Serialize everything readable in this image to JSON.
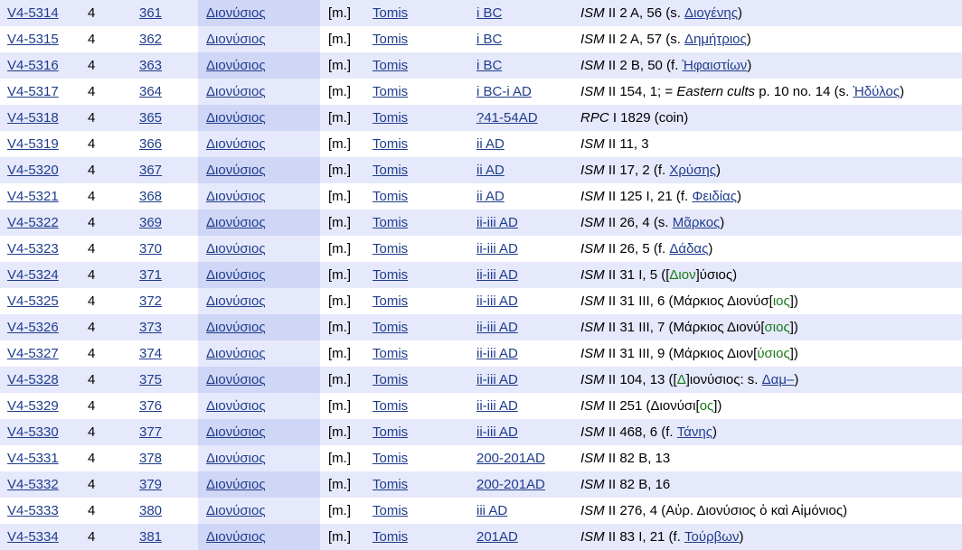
{
  "rows": [
    {
      "id": "V4-5314",
      "vol": "4",
      "num": "361",
      "name": "Διονύσιος",
      "sex": "[m.]",
      "place": "Tomis",
      "date": "i BC",
      "ref": [
        {
          "t": "ISM",
          "i": 1
        },
        {
          "t": " II 2 A, 56 (s. "
        },
        {
          "t": "Διογένης",
          "l": 1
        },
        {
          "t": ")"
        }
      ]
    },
    {
      "id": "V4-5315",
      "vol": "4",
      "num": "362",
      "name": "Διονύσιος",
      "sex": "[m.]",
      "place": "Tomis",
      "date": "i BC",
      "ref": [
        {
          "t": "ISM",
          "i": 1
        },
        {
          "t": " II 2 A, 57 (s. "
        },
        {
          "t": "Δημήτριος",
          "l": 1
        },
        {
          "t": ")"
        }
      ]
    },
    {
      "id": "V4-5316",
      "vol": "4",
      "num": "363",
      "name": "Διονύσιος",
      "sex": "[m.]",
      "place": "Tomis",
      "date": "i BC",
      "ref": [
        {
          "t": "ISM",
          "i": 1
        },
        {
          "t": " II 2 B, 50 (f. "
        },
        {
          "t": "Ἡφαιστίων",
          "l": 1
        },
        {
          "t": ")"
        }
      ]
    },
    {
      "id": "V4-5317",
      "vol": "4",
      "num": "364",
      "name": "Διονύσιος",
      "sex": "[m.]",
      "place": "Tomis",
      "date": "i BC-i AD",
      "ref": [
        {
          "t": "ISM",
          "i": 1
        },
        {
          "t": " II 154, 1; = "
        },
        {
          "t": "Eastern cults",
          "i": 1
        },
        {
          "t": " p. 10 no. 14 (s. "
        },
        {
          "t": "Ἡδύλος",
          "l": 1
        },
        {
          "t": ")"
        }
      ]
    },
    {
      "id": "V4-5318",
      "vol": "4",
      "num": "365",
      "name": "Διονύσιος",
      "sex": "[m.]",
      "place": "Tomis",
      "date": "?41-54AD",
      "ref": [
        {
          "t": "RPC",
          "i": 1
        },
        {
          "t": " I 1829 (coin)"
        }
      ]
    },
    {
      "id": "V4-5319",
      "vol": "4",
      "num": "366",
      "name": "Διονύσιος",
      "sex": "[m.]",
      "place": "Tomis",
      "date": "ii AD",
      "ref": [
        {
          "t": "ISM",
          "i": 1
        },
        {
          "t": " II 11, 3"
        }
      ]
    },
    {
      "id": "V4-5320",
      "vol": "4",
      "num": "367",
      "name": "Διονύσιος",
      "sex": "[m.]",
      "place": "Tomis",
      "date": "ii AD",
      "ref": [
        {
          "t": "ISM",
          "i": 1
        },
        {
          "t": " II 17, 2 (f. "
        },
        {
          "t": "Χρύσης",
          "l": 1
        },
        {
          "t": ")"
        }
      ]
    },
    {
      "id": "V4-5321",
      "vol": "4",
      "num": "368",
      "name": "Διονύσιος",
      "sex": "[m.]",
      "place": "Tomis",
      "date": "ii AD",
      "ref": [
        {
          "t": "ISM",
          "i": 1
        },
        {
          "t": " II 125 I, 21 (f. "
        },
        {
          "t": "Φειδίας",
          "l": 1
        },
        {
          "t": ")"
        }
      ]
    },
    {
      "id": "V4-5322",
      "vol": "4",
      "num": "369",
      "name": "Διονύσιος",
      "sex": "[m.]",
      "place": "Tomis",
      "date": "ii-iii AD",
      "ref": [
        {
          "t": "ISM",
          "i": 1
        },
        {
          "t": " II 26, 4 (s. "
        },
        {
          "t": "Μᾶρκος",
          "l": 1
        },
        {
          "t": ")"
        }
      ]
    },
    {
      "id": "V4-5323",
      "vol": "4",
      "num": "370",
      "name": "Διονύσιος",
      "sex": "[m.]",
      "place": "Tomis",
      "date": "ii-iii AD",
      "ref": [
        {
          "t": "ISM",
          "i": 1
        },
        {
          "t": " II 26, 5 (f. "
        },
        {
          "t": "Δάδας",
          "l": 1
        },
        {
          "t": ")"
        }
      ]
    },
    {
      "id": "V4-5324",
      "vol": "4",
      "num": "371",
      "name": "Διονύσιος",
      "sex": "[m.]",
      "place": "Tomis",
      "date": "ii-iii AD",
      "ref": [
        {
          "t": "ISM",
          "i": 1
        },
        {
          "t": " II 31 I, 5 (["
        },
        {
          "t": "Διον",
          "g": 1
        },
        {
          "t": "]ύσιος)"
        }
      ]
    },
    {
      "id": "V4-5325",
      "vol": "4",
      "num": "372",
      "name": "Διονύσιος",
      "sex": "[m.]",
      "place": "Tomis",
      "date": "ii-iii AD",
      "ref": [
        {
          "t": "ISM",
          "i": 1
        },
        {
          "t": " II 31 III, 6 (Μάρκιος Διονύσ["
        },
        {
          "t": "ιος",
          "g": 1
        },
        {
          "t": "])"
        }
      ]
    },
    {
      "id": "V4-5326",
      "vol": "4",
      "num": "373",
      "name": "Διονύσιος",
      "sex": "[m.]",
      "place": "Tomis",
      "date": "ii-iii AD",
      "ref": [
        {
          "t": "ISM",
          "i": 1
        },
        {
          "t": " II 31 III, 7 (Μάρκιος Διονύ["
        },
        {
          "t": "σιος",
          "g": 1
        },
        {
          "t": "])"
        }
      ]
    },
    {
      "id": "V4-5327",
      "vol": "4",
      "num": "374",
      "name": "Διονύσιος",
      "sex": "[m.]",
      "place": "Tomis",
      "date": "ii-iii AD",
      "ref": [
        {
          "t": "ISM",
          "i": 1
        },
        {
          "t": " II 31 III, 9 (Μάρκιος Διον["
        },
        {
          "t": "ύσιος",
          "g": 1
        },
        {
          "t": "])"
        }
      ]
    },
    {
      "id": "V4-5328",
      "vol": "4",
      "num": "375",
      "name": "Διονύσιος",
      "sex": "[m.]",
      "place": "Tomis",
      "date": "ii-iii AD",
      "ref": [
        {
          "t": "ISM",
          "i": 1
        },
        {
          "t": " II 104, 13 (["
        },
        {
          "t": "Δ",
          "g": 1
        },
        {
          "t": "]ιονύσιος: s. "
        },
        {
          "t": "Δαμ–",
          "l": 1
        },
        {
          "t": ")"
        }
      ]
    },
    {
      "id": "V4-5329",
      "vol": "4",
      "num": "376",
      "name": "Διονύσιος",
      "sex": "[m.]",
      "place": "Tomis",
      "date": "ii-iii AD",
      "ref": [
        {
          "t": "ISM",
          "i": 1
        },
        {
          "t": " II 251 (Διονύσι["
        },
        {
          "t": "ος",
          "g": 1
        },
        {
          "t": "])"
        }
      ]
    },
    {
      "id": "V4-5330",
      "vol": "4",
      "num": "377",
      "name": "Διονύσιος",
      "sex": "[m.]",
      "place": "Tomis",
      "date": "ii-iii AD",
      "ref": [
        {
          "t": "ISM",
          "i": 1
        },
        {
          "t": " II 468, 6 (f. "
        },
        {
          "t": "Τάνης",
          "l": 1
        },
        {
          "t": ")"
        }
      ]
    },
    {
      "id": "V4-5331",
      "vol": "4",
      "num": "378",
      "name": "Διονύσιος",
      "sex": "[m.]",
      "place": "Tomis",
      "date": "200-201AD",
      "ref": [
        {
          "t": "ISM",
          "i": 1
        },
        {
          "t": " II 82 B, 13"
        }
      ]
    },
    {
      "id": "V4-5332",
      "vol": "4",
      "num": "379",
      "name": "Διονύσιος",
      "sex": "[m.]",
      "place": "Tomis",
      "date": "200-201AD",
      "ref": [
        {
          "t": "ISM",
          "i": 1
        },
        {
          "t": " II 82 B, 16"
        }
      ]
    },
    {
      "id": "V4-5333",
      "vol": "4",
      "num": "380",
      "name": "Διονύσιος",
      "sex": "[m.]",
      "place": "Tomis",
      "date": "iii AD",
      "ref": [
        {
          "t": "ISM",
          "i": 1
        },
        {
          "t": " II 276, 4 (Αὐρ. Διονύσιος ὁ καὶ Αἰμόνιος)"
        }
      ]
    },
    {
      "id": "V4-5334",
      "vol": "4",
      "num": "381",
      "name": "Διονύσιος",
      "sex": "[m.]",
      "place": "Tomis",
      "date": "201AD",
      "ref": [
        {
          "t": "ISM",
          "i": 1
        },
        {
          "t": " II 83 I, 21 (f. "
        },
        {
          "t": "Τούρβων",
          "l": 1
        },
        {
          "t": ")"
        }
      ]
    }
  ],
  "colors": {
    "link": "#1f3d8c",
    "supplement": "#167a16",
    "row_odd": "#e6e9fb",
    "name_col": "#d0d6f6"
  }
}
